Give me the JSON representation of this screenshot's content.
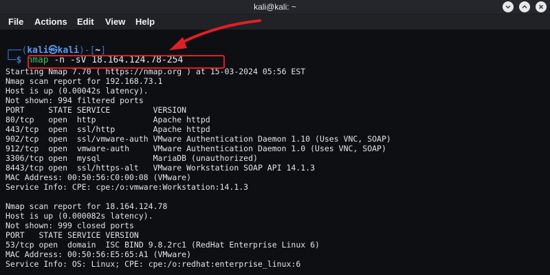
{
  "window": {
    "title": "kali@kali: ~",
    "controls": [
      "minimize",
      "maximize",
      "close"
    ]
  },
  "menu": [
    "File",
    "Actions",
    "Edit",
    "View",
    "Help"
  ],
  "prompt": {
    "open": "┌──(",
    "user": "kali㉿kali",
    "mid": ")-[",
    "cwd": "~",
    "close": "]",
    "corner": "└─",
    "dollar": "$",
    "command_name": "nmap",
    "command_args": " -n -sV 18.164.124.78-254"
  },
  "annotation": {
    "arrow_color": "#e01f26",
    "box_color": "#e01f26"
  },
  "output": [
    "Starting Nmap 7.70 ( https://nmap.org ) at 15-03-2024 05:56 EST",
    "Nmap scan report for 192.168.73.1",
    "Host is up (0.00042s latency).",
    "Not shown: 994 filtered ports",
    "PORT     STATE SERVICE         VERSION",
    "80/tcp   open  http            Apache httpd",
    "443/tcp  open  ssl/http        Apache httpd",
    "902/tcp  open  ssl/vmware-auth VMware Authentication Daemon 1.10 (Uses VNC, SOAP)",
    "912/tcp  open  vmware-auth     VMware Authentication Daemon 1.0 (Uses VNC, SOAP)",
    "3306/tcp open  mysql           MariaDB (unauthorized)",
    "8443/tcp open  ssl/https-alt   VMware Workstation SOAP API 14.1.3",
    "MAC Address: 00:50:56:C0:00:08 (VMware)",
    "Service Info: CPE: cpe:/o:vmware:Workstation:14.1.3",
    "",
    "Nmap scan report for 18.164.124.78",
    "Host is up (0.000082s latency).",
    "Not shown: 999 closed ports",
    "PORT   STATE SERVICE VERSION",
    "53/tcp open  domain  ISC BIND 9.8.2rc1 (RedHat Enterprise Linux 6)",
    "MAC Address: 00:50:56:E5:65:A1 (VMware)",
    "Service Info: OS: Linux; CPE: cpe:/o:redhat:enterprise_linux:6"
  ]
}
